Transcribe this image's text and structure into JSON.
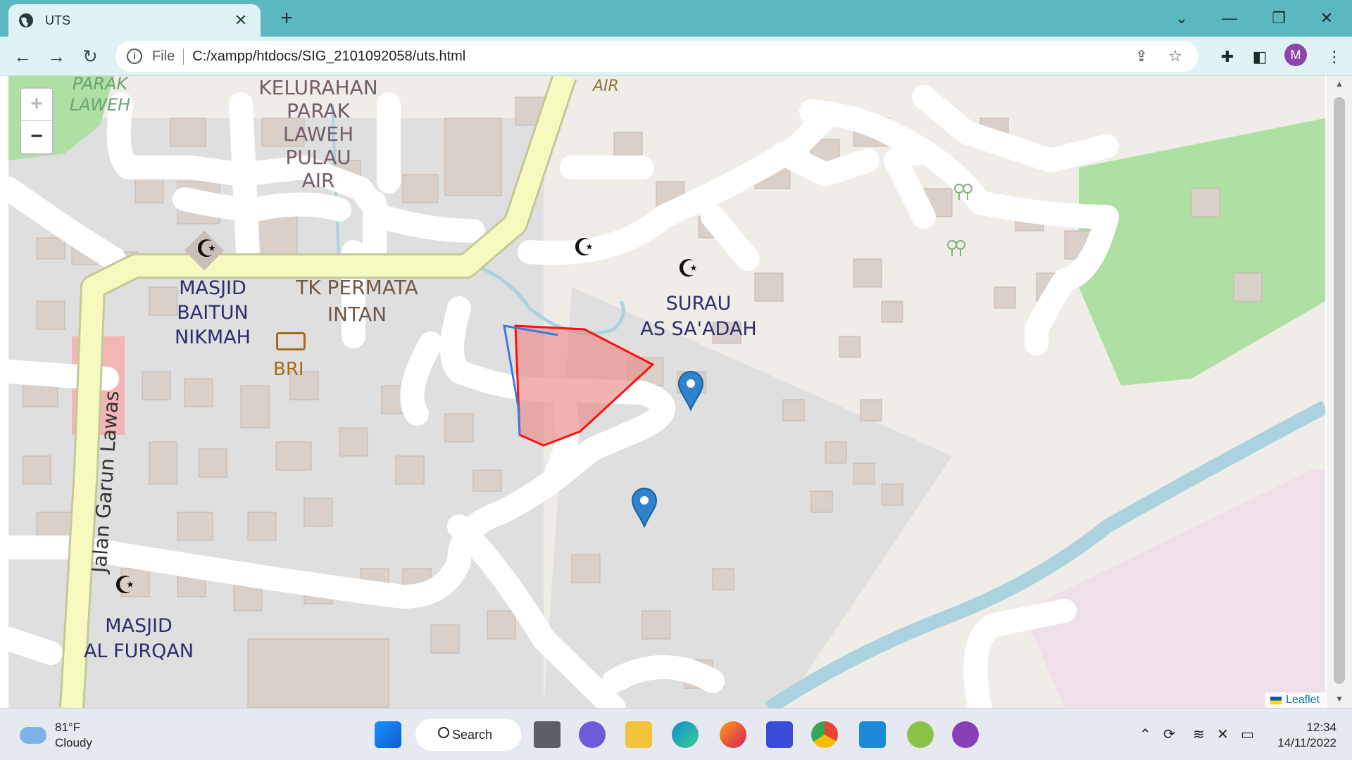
{
  "browser": {
    "tab_title": "UTS",
    "new_tab": "+",
    "address_scheme": "File",
    "address_url": "C:/xampp/htdocs/SIG_2101092058/uts.html",
    "profile_initial": "M"
  },
  "map": {
    "zoom_in": "+",
    "zoom_out": "−",
    "attribution": "Leaflet",
    "labels": {
      "kelurahan": [
        "KELURAHAN",
        "PARAK",
        "LAWEH",
        "PULAU",
        "AIR"
      ],
      "parak_laweh_top": [
        "PARAK",
        "LAWEH"
      ],
      "air_top": "AIR",
      "masjid_baitun": [
        "MASJID",
        "BAITUN",
        "NIKMAH"
      ],
      "tk_permata": [
        "TK PERMATA",
        "INTAN"
      ],
      "bri": "BRI",
      "surau": [
        "SURAU",
        "AS SA'ADAH"
      ],
      "masjid_furqan": [
        "MASJID",
        "AL FURQAN"
      ],
      "street": "Jalan Garun Lawas"
    },
    "icons": [
      "crescent-icon",
      "bank-icon",
      "map-marker-icon",
      "tree-icon"
    ],
    "colors": {
      "polygon_fill": "#e88a88",
      "polygon_stroke": "#ff1010",
      "line": "#3a7be0",
      "marker": "#2e83cc",
      "primary_road": "#f6fabe",
      "water": "#aad3df",
      "park": "#aedfa3",
      "residential": "#e0dfdf"
    }
  },
  "taskbar": {
    "weather_temp": "81°F",
    "weather_desc": "Cloudy",
    "search_label": "Search",
    "time": "12:34",
    "date": "14/11/2022"
  }
}
